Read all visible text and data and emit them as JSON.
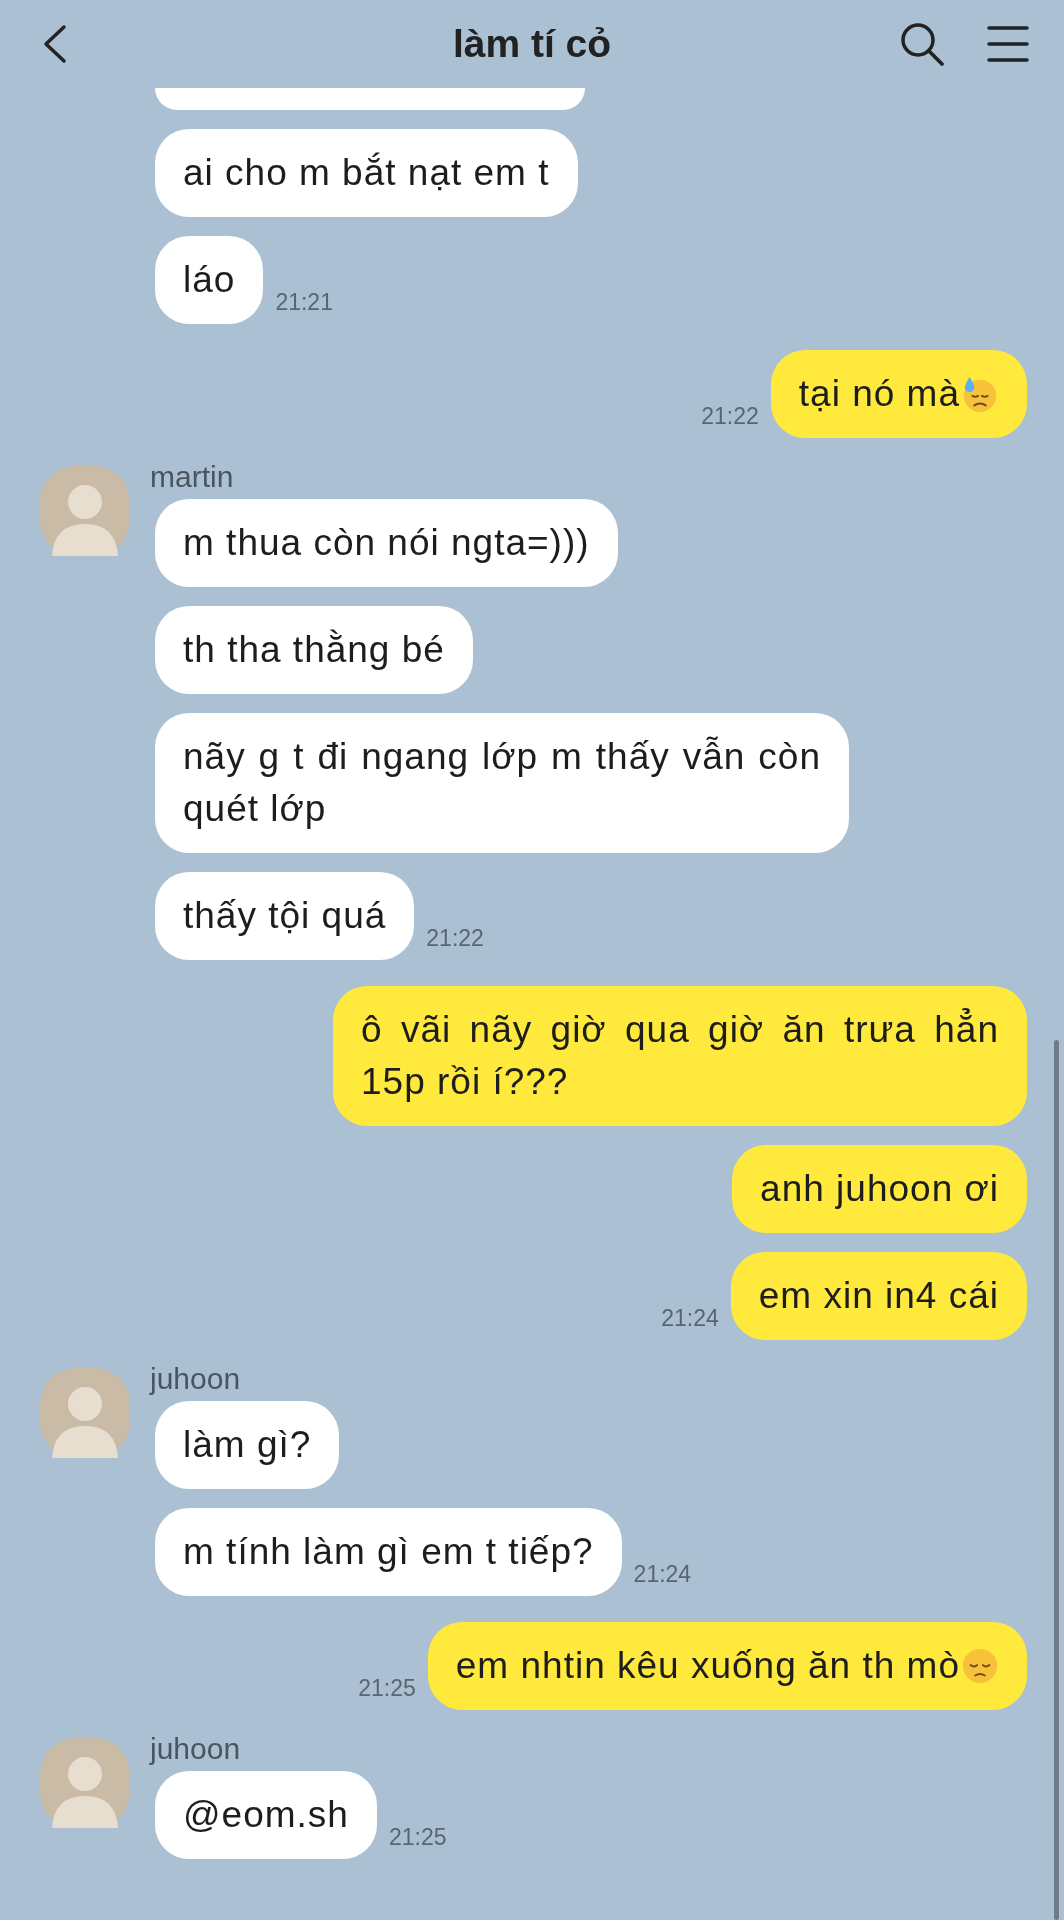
{
  "header": {
    "title": "làm tí cỏ"
  },
  "groups": [
    {
      "kind": "incoming",
      "messages": [
        {
          "kind": "cut"
        },
        {
          "kind": "text",
          "text": "ai cho m bắt nạt em t"
        },
        {
          "kind": "text",
          "text": "láo",
          "time": "21:21"
        }
      ]
    },
    {
      "kind": "outgoing",
      "messages": [
        {
          "kind": "sweat",
          "text": "tại nó mà",
          "time": "21:22"
        }
      ]
    },
    {
      "kind": "incoming",
      "sender": "martin",
      "messages": [
        {
          "kind": "text",
          "text": "m thua còn nói ngta=)))"
        },
        {
          "kind": "text",
          "text": "th tha thằng bé"
        },
        {
          "kind": "text",
          "text": "nãy g t đi ngang lớp m thấy vẫn còn quét lớp"
        },
        {
          "kind": "text",
          "text": "thấy tội quá",
          "time": "21:22"
        }
      ]
    },
    {
      "kind": "outgoing",
      "messages": [
        {
          "kind": "text",
          "text": "ô vãi nãy giờ qua giờ ăn trưa hẳn 15p rồi í???"
        },
        {
          "kind": "text",
          "text": "anh juhoon ơi"
        },
        {
          "kind": "text",
          "text": "em xin in4 cái",
          "time": "21:24"
        }
      ]
    },
    {
      "kind": "incoming",
      "sender": "juhoon",
      "messages": [
        {
          "kind": "text",
          "text": "làm gì?"
        },
        {
          "kind": "text",
          "text": "m tính làm gì em t tiếp?",
          "time": "21:24"
        }
      ]
    },
    {
      "kind": "outgoing",
      "messages": [
        {
          "kind": "pensive",
          "text": "em nhtin kêu xuống ăn th mò",
          "time": "21:25"
        }
      ]
    },
    {
      "kind": "incoming",
      "sender": "juhoon",
      "messages": [
        {
          "kind": "text",
          "text": "@eom.sh",
          "time": "21:25"
        }
      ]
    }
  ]
}
